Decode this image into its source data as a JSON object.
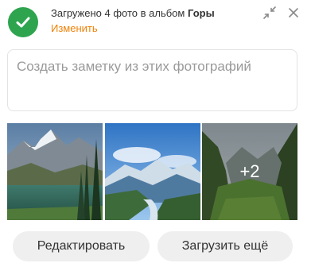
{
  "header": {
    "status_prefix": "Загружено 4 фото в альбом ",
    "album_name": "Горы",
    "change_link": "Изменить"
  },
  "note": {
    "placeholder": "Создать заметку из этих фотографий"
  },
  "photos": {
    "more_count": "+2"
  },
  "actions": {
    "edit_label": "Редактировать",
    "upload_more_label": "Загрузить ещё"
  },
  "colors": {
    "success": "#2ea44f",
    "link": "#ee8208",
    "button_bg": "#efefef"
  }
}
